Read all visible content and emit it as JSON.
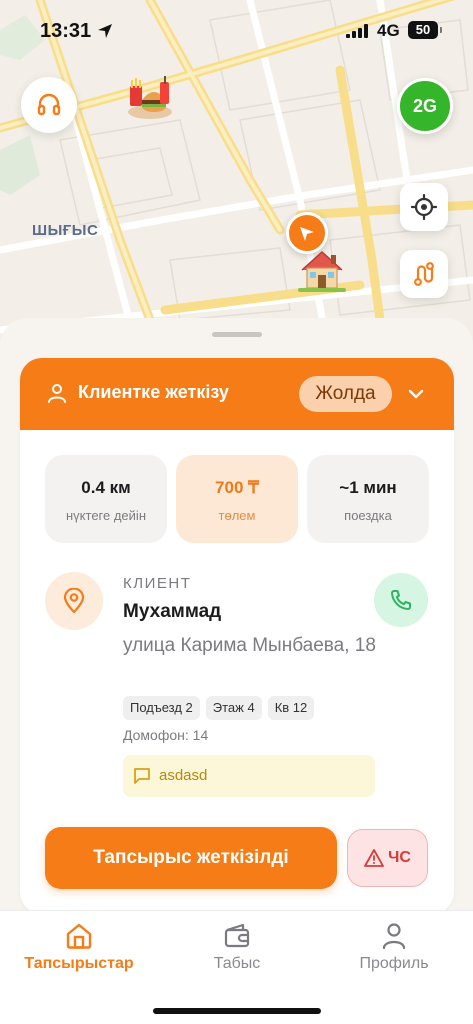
{
  "status_bar": {
    "time": "13:31",
    "network": "4G",
    "battery": "50"
  },
  "map": {
    "district_label": "ШЫҒЫС",
    "network_badge": "2G",
    "icons": [
      "headphones-icon",
      "food-marker",
      "house-marker",
      "courier-marker",
      "locate-icon",
      "route-icon"
    ]
  },
  "order_card": {
    "header": {
      "title": "Клиентке жеткізу",
      "status_pill": "Жолда"
    },
    "stats": [
      {
        "value": "0.4 км",
        "label": "нүктеге дейін"
      },
      {
        "value": "700 ₸",
        "label": "төлем"
      },
      {
        "value": "~1 мин",
        "label": "поездка"
      }
    ],
    "client": {
      "section_label": "КЛИЕНТ",
      "name": "Мухаммад",
      "address": "улица Карима Мынбаева, 18",
      "chips": [
        "Подъезд 2",
        "Этаж 4",
        "Кв 12"
      ],
      "intercom": "Домофон: 14",
      "comment": "asdasd"
    },
    "actions": {
      "deliver_label": "Тапсырыс жеткізілді",
      "sos_label": "ЧС"
    }
  },
  "bottom_nav": {
    "items": [
      {
        "label": "Тапсырыстар",
        "icon": "home-icon",
        "active": true
      },
      {
        "label": "Табыс",
        "icon": "wallet-icon",
        "active": false
      },
      {
        "label": "Профиль",
        "icon": "user-icon",
        "active": false
      }
    ]
  },
  "colors": {
    "accent": "#f57c16",
    "accent_soft": "#fde8d6",
    "success": "#35b52a",
    "danger": "#d83b3b"
  }
}
